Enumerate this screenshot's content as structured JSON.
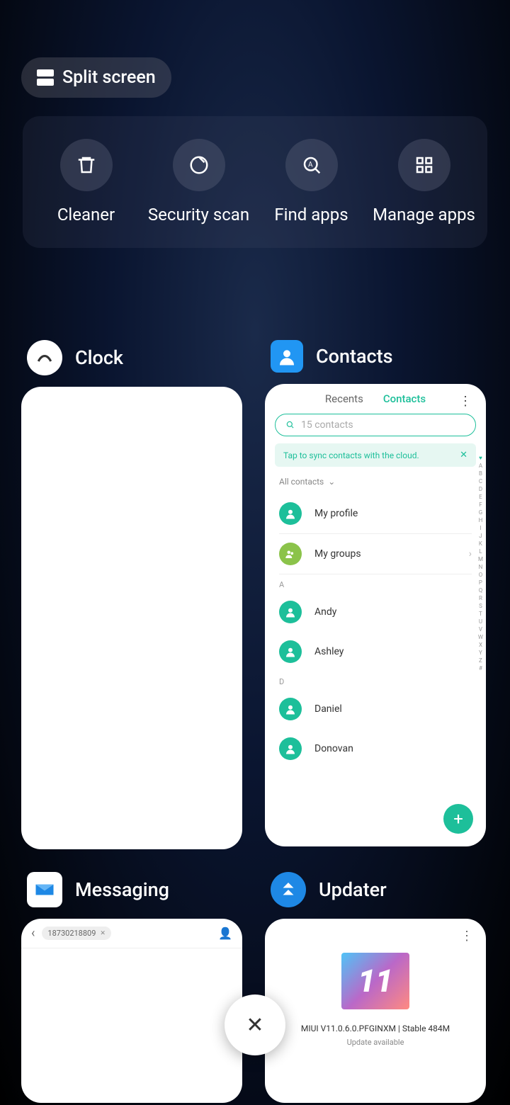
{
  "split_screen": "Split screen",
  "tools": {
    "cleaner": "Cleaner",
    "security": "Security scan",
    "find": "Find apps",
    "manage": "Manage apps"
  },
  "apps": {
    "clock": "Clock",
    "contacts": "Contacts",
    "messaging": "Messaging",
    "updater": "Updater"
  },
  "contacts": {
    "tab_recents": "Recents",
    "tab_contacts": "Contacts",
    "search_placeholder": "15 contacts",
    "sync_msg": "Tap to sync contacts with the cloud.",
    "all": "All contacts",
    "profile": "My profile",
    "groups": "My groups",
    "section_a": "A",
    "andy": "Andy",
    "ashley": "Ashley",
    "section_d": "D",
    "daniel": "Daniel",
    "donovan": "Donovan"
  },
  "messaging": {
    "number": "18730218809"
  },
  "updater": {
    "version": "MIUI V11.0.6.0.PFGINXM | Stable 484M",
    "status": "Update available"
  }
}
